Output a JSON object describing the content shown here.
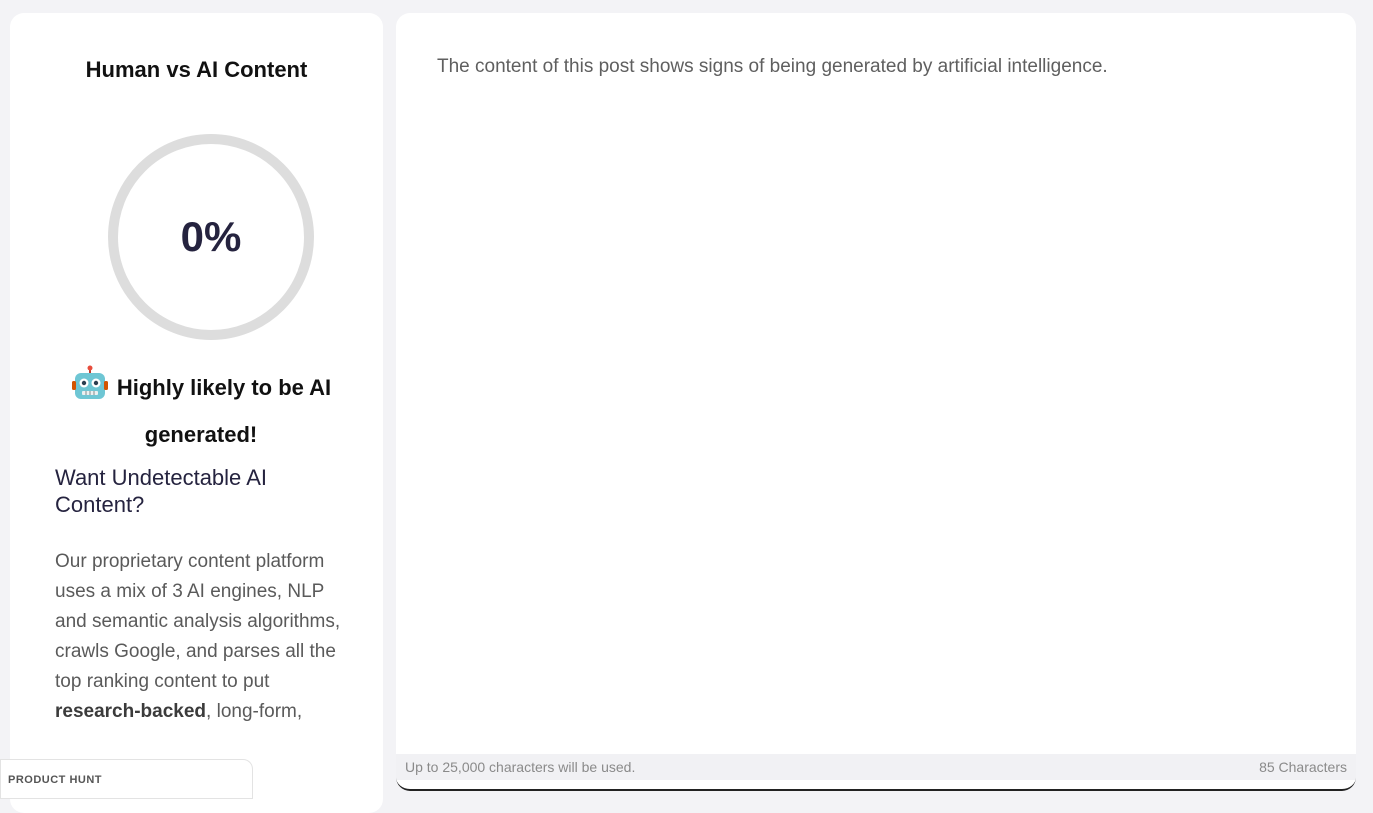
{
  "detector": {
    "title": "Human vs AI Content",
    "score_text": "0%",
    "score_value": 0,
    "verdict": "Highly likely to be AI generated!",
    "verdict_icon": "robot-icon",
    "ring_color": "#dddddd"
  },
  "promo": {
    "heading": "Want Undetectable AI Content?",
    "body_lead": "Our proprietary content platform uses a mix of 3 AI engines, NLP and semantic analysis algorithms, crawls Google, and parses all the top ranking content to put ",
    "body_bold": "research-backed",
    "body_tail": ", long-form,"
  },
  "product_hunt": {
    "label": "PRODUCT HUNT"
  },
  "result": {
    "message": "The content of this post shows signs of being generated by artificial intelligence."
  },
  "footer": {
    "limit_text": "Up to 25,000 characters will be used.",
    "char_count": "85 Characters"
  }
}
